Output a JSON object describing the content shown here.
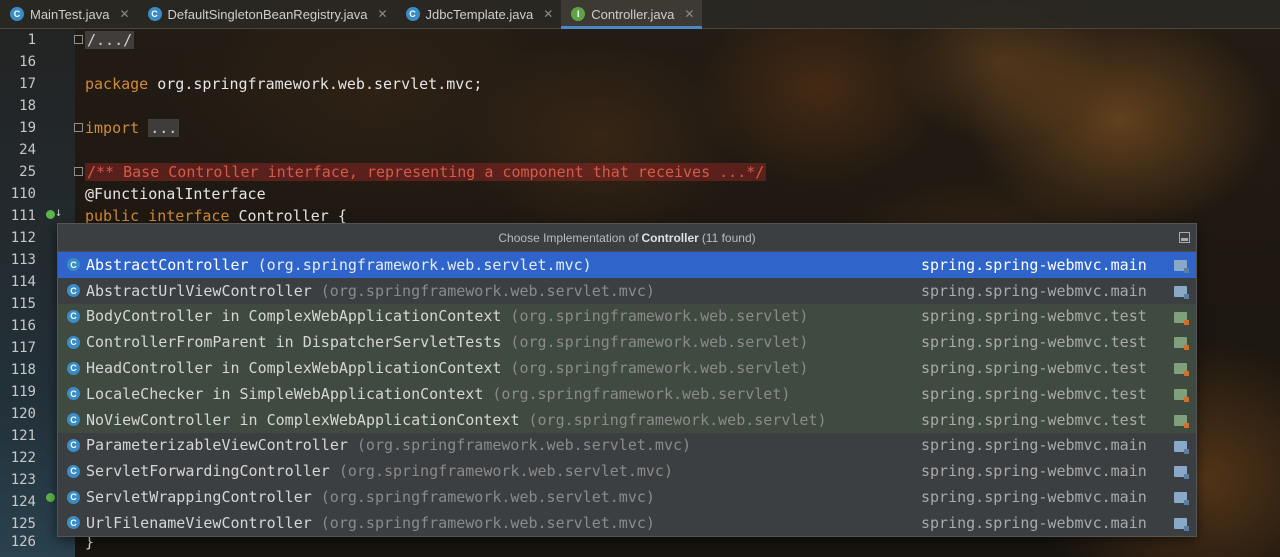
{
  "tabs": [
    {
      "label": "MainTest.java",
      "icon": "C",
      "active": false
    },
    {
      "label": "DefaultSingletonBeanRegistry.java",
      "icon": "C",
      "active": false
    },
    {
      "label": "JdbcTemplate.java",
      "icon": "C",
      "active": false
    },
    {
      "label": "Controller.java",
      "icon": "I",
      "active": true
    }
  ],
  "editor": {
    "line_numbers": [
      "1",
      "16",
      "17",
      "18",
      "19",
      "24",
      "25",
      "110",
      "111",
      "112",
      "113",
      "114",
      "115",
      "116",
      "117",
      "118",
      "119",
      "120",
      "121",
      "122",
      "123",
      "124",
      "125",
      "126"
    ],
    "code": {
      "l1": "/.../",
      "l17_kw": "package",
      "l17_rest": " org.springframework.web.servlet.mvc;",
      "l19_kw": "import",
      "l19_fold": "...",
      "l25_comment": "/** Base Controller interface, representing a component that receives ...*/",
      "l110": "@FunctionalInterface",
      "l111_kw": "public interface",
      "l111_rest": " Controller {",
      "l126": "}"
    }
  },
  "popup": {
    "title_prefix": "Choose Implementation of",
    "title_class": "Controller",
    "title_suffix": "(11 found)",
    "rows": [
      {
        "name": "AbstractController",
        "pkg": "(org.springframework.web.servlet.mvc)",
        "module": "spring.spring-webmvc.main",
        "kind": "main",
        "selected": true,
        "abstract": true
      },
      {
        "name": "AbstractUrlViewController",
        "pkg": "(org.springframework.web.servlet.mvc)",
        "module": "spring.spring-webmvc.main",
        "kind": "main",
        "selected": false,
        "abstract": true
      },
      {
        "name": "BodyController in ComplexWebApplicationContext",
        "pkg": "(org.springframework.web.servlet)",
        "module": "spring.spring-webmvc.test",
        "kind": "test",
        "selected": false
      },
      {
        "name": "ControllerFromParent in DispatcherServletTests",
        "pkg": "(org.springframework.web.servlet)",
        "module": "spring.spring-webmvc.test",
        "kind": "test",
        "selected": false
      },
      {
        "name": "HeadController in ComplexWebApplicationContext",
        "pkg": "(org.springframework.web.servlet)",
        "module": "spring.spring-webmvc.test",
        "kind": "test",
        "selected": false
      },
      {
        "name": "LocaleChecker in SimpleWebApplicationContext",
        "pkg": "(org.springframework.web.servlet)",
        "module": "spring.spring-webmvc.test",
        "kind": "test",
        "selected": false
      },
      {
        "name": "NoViewController in ComplexWebApplicationContext",
        "pkg": "(org.springframework.web.servlet)",
        "module": "spring.spring-webmvc.test",
        "kind": "test",
        "selected": false
      },
      {
        "name": "ParameterizableViewController",
        "pkg": "(org.springframework.web.servlet.mvc)",
        "module": "spring.spring-webmvc.main",
        "kind": "main",
        "selected": false
      },
      {
        "name": "ServletForwardingController",
        "pkg": "(org.springframework.web.servlet.mvc)",
        "module": "spring.spring-webmvc.main",
        "kind": "main",
        "selected": false
      },
      {
        "name": "ServletWrappingController",
        "pkg": "(org.springframework.web.servlet.mvc)",
        "module": "spring.spring-webmvc.main",
        "kind": "main",
        "selected": false
      },
      {
        "name": "UrlFilenameViewController",
        "pkg": "(org.springframework.web.servlet.mvc)",
        "module": "spring.spring-webmvc.main",
        "kind": "main",
        "selected": false
      }
    ]
  },
  "colors": {
    "selection": "#2f65ca",
    "test_row": "#3f4a40",
    "keyword": "#d08a3a",
    "comment": "#d35b4a",
    "tab_accent": "#4a88c7"
  },
  "icons": {
    "class": "class-icon",
    "interface": "interface-icon",
    "module": "module-folder-icon",
    "implemented": "implemented-gutter-icon"
  }
}
